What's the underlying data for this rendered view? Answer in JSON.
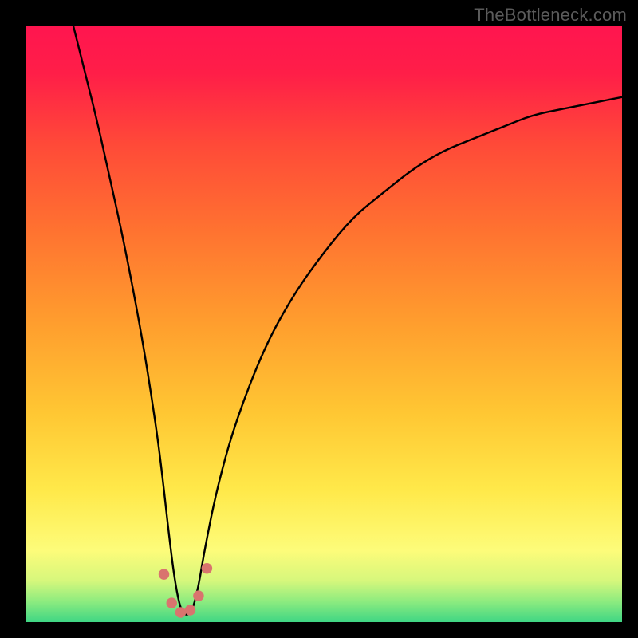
{
  "watermark": "TheBottleneck.com",
  "chart_data": {
    "type": "line",
    "title": "",
    "xlabel": "",
    "ylabel": "",
    "xlim": [
      0,
      100
    ],
    "ylim": [
      0,
      100
    ],
    "grid": false,
    "background_gradient_stops": [
      {
        "offset": 0.0,
        "color": "#ff154f"
      },
      {
        "offset": 0.08,
        "color": "#ff1e48"
      },
      {
        "offset": 0.2,
        "color": "#ff4a38"
      },
      {
        "offset": 0.35,
        "color": "#ff7430"
      },
      {
        "offset": 0.5,
        "color": "#ff9e2e"
      },
      {
        "offset": 0.65,
        "color": "#ffc733"
      },
      {
        "offset": 0.78,
        "color": "#ffe94a"
      },
      {
        "offset": 0.88,
        "color": "#fdfc7a"
      },
      {
        "offset": 0.93,
        "color": "#d7f77c"
      },
      {
        "offset": 0.965,
        "color": "#8eec7f"
      },
      {
        "offset": 1.0,
        "color": "#3fd684"
      }
    ],
    "series": [
      {
        "name": "bottleneck-curve",
        "color": "#000000",
        "x": [
          8,
          10,
          12,
          14,
          16,
          18,
          20,
          22,
          23,
          24,
          25,
          26,
          27,
          28,
          29,
          30,
          32,
          35,
          40,
          45,
          50,
          55,
          60,
          65,
          70,
          75,
          80,
          85,
          90,
          95,
          100
        ],
        "y": [
          100,
          92,
          84,
          75,
          66,
          56,
          45,
          32,
          24,
          15,
          7,
          2,
          1,
          2,
          6,
          12,
          22,
          33,
          46,
          55,
          62,
          68,
          72,
          76,
          79,
          81,
          83,
          85,
          86,
          87,
          88
        ]
      }
    ],
    "markers": {
      "name": "bottleneck-minimum-dots",
      "color": "#d9746e",
      "radius_pct": 0.9,
      "points": [
        {
          "x": 23.2,
          "y": 8.0
        },
        {
          "x": 24.5,
          "y": 3.2
        },
        {
          "x": 26.0,
          "y": 1.6
        },
        {
          "x": 27.6,
          "y": 2.0
        },
        {
          "x": 29.0,
          "y": 4.4
        },
        {
          "x": 30.4,
          "y": 9.0
        }
      ]
    }
  }
}
